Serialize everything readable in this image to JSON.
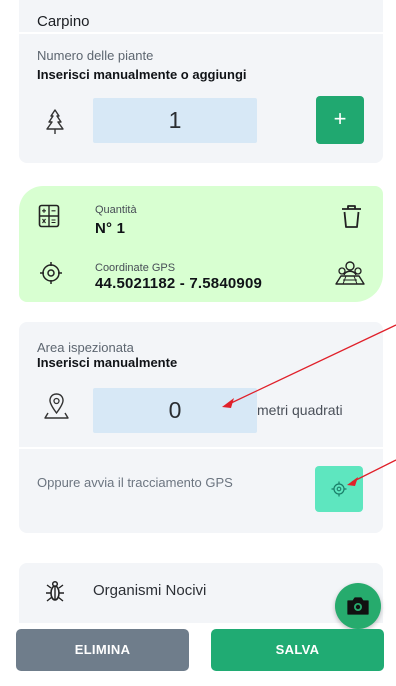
{
  "colors": {
    "accent": "#20a870",
    "input_background": "#d7e8f6",
    "summary_background": "#d8ffd1",
    "gps_button": "#5ee6bf",
    "delete_button": "#6f7d8b",
    "save_button": "#20ab73",
    "annotation_arrow": "#e0202a"
  },
  "species": {
    "name": "Carpino"
  },
  "plants": {
    "label": "Numero delle piante",
    "instruction": "Inserisci manualmente o aggiungi",
    "value": "1",
    "add_label": "+",
    "icon": "tree-icon"
  },
  "summary": {
    "quantity_label": "Quantità",
    "quantity_value": "N° 1",
    "gps_label": "Coordinate GPS",
    "gps_value": "44.5021182 - 7.5840909",
    "icons": [
      "calculator-icon",
      "trash-icon",
      "crosshair-icon",
      "map-people-icon"
    ]
  },
  "area": {
    "label": "Area ispezionata",
    "instruction": "Inserisci manualmente",
    "value": "0",
    "unit": "metri quadrati",
    "gps_tracking_text": "Oppure avvia il tracciamento GPS",
    "icons": [
      "map-pin-icon",
      "gps-crosshair-icon"
    ]
  },
  "organisms": {
    "label": "Organismi Nocivi",
    "icon": "bug-icon"
  },
  "camera": {
    "icon": "camera-icon"
  },
  "buttons": {
    "delete": "ELIMINA",
    "save": "SALVA"
  }
}
